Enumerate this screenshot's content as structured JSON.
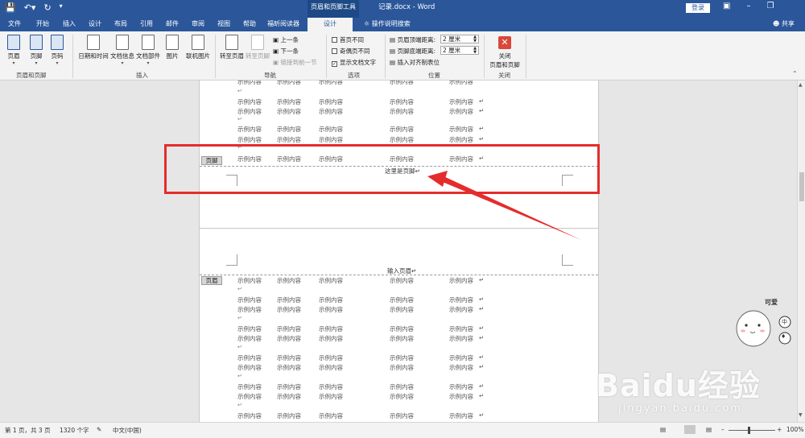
{
  "titlebar": {
    "context_tool": "页眉和页脚工具",
    "doc_title": "记录.docx  -  Word",
    "login": "登录"
  },
  "tabs": [
    "文件",
    "开始",
    "插入",
    "设计",
    "布局",
    "引用",
    "邮件",
    "审阅",
    "视图",
    "帮助",
    "福昕阅读器",
    "设计",
    "操作说明搜索"
  ],
  "share": "共享",
  "ribbon": {
    "header": "页眉",
    "footer": "页脚",
    "page_number": "页码",
    "group_hf": "页眉和页脚",
    "date_time": "日期和时间",
    "doc_info": "文档信息",
    "doc_parts": "文档部件",
    "picture": "图片",
    "online_picture": "联机图片",
    "group_insert": "插入",
    "goto_header": "转至页眉",
    "goto_footer": "转至页脚",
    "prev": "上一条",
    "next": "下一条",
    "link_prev": "链接到前一节",
    "group_nav": "导航",
    "diff_first": "首页不同",
    "diff_odd_even": "奇偶页不同",
    "show_doc_text": "显示文档文字",
    "group_options": "选项",
    "header_top_label": "页眉顶端距离:",
    "header_top_value": "2 厘米",
    "footer_bottom_label": "页脚底端距离:",
    "footer_bottom_value": "2 厘米",
    "insert_align_tab": "插入对齐制表位",
    "group_position": "位置",
    "close_hf_line1": "关闭",
    "close_hf_line2": "页眉和页脚",
    "group_close": "关闭"
  },
  "document": {
    "cell_text": "示例内容",
    "para_mark": "↵",
    "footer_tag": "页脚",
    "footer_text": "这里是页脚↵",
    "header_tag": "页眉",
    "header_text": "输入页眉↵"
  },
  "status": {
    "page": "第 1 页，共 3 页",
    "words": "1320 个字",
    "language": "中文(中国)",
    "zoom": "100%"
  },
  "mascot": {
    "label": "可爱",
    "badge1": "中"
  },
  "watermark": {
    "logo": "Baidu经验",
    "url": "jingyan.baidu.com"
  },
  "colors": {
    "word_blue": "#2b579a",
    "annotation_red": "#e52c2c"
  }
}
